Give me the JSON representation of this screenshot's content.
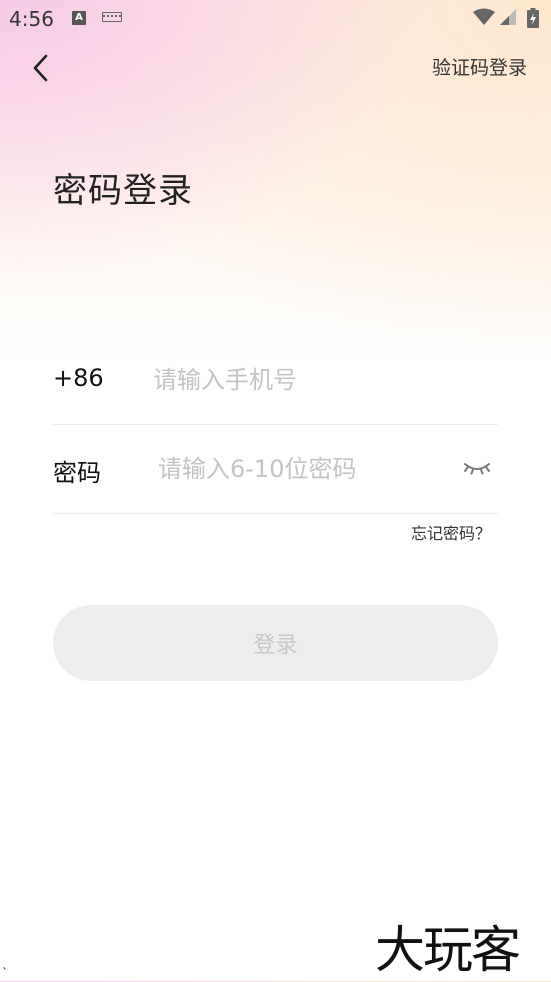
{
  "status_bar": {
    "time": "4:56",
    "a_icon_letter": "A",
    "icons": [
      "a-icon",
      "keyboard-icon",
      "wifi-icon",
      "signal-icon",
      "battery-icon"
    ]
  },
  "header": {
    "back_icon": "chevron-left-icon",
    "sms_login_label": "验证码登录"
  },
  "title": "密码登录",
  "form": {
    "phone": {
      "country_code": "+86",
      "value": "",
      "placeholder": "请输入手机号"
    },
    "password": {
      "label": "密码",
      "value": "",
      "placeholder": "请输入6-10位密码",
      "toggle_icon": "eye-closed-icon"
    },
    "forgot_label": "忘记密码？"
  },
  "login_button_label": "登录",
  "watermark": "大玩客",
  "corner_mark": "`",
  "colors": {
    "button_bg": "#ededed",
    "button_text": "#c7c7c7",
    "placeholder": "#c4c4c4",
    "divider": "#ececec"
  }
}
